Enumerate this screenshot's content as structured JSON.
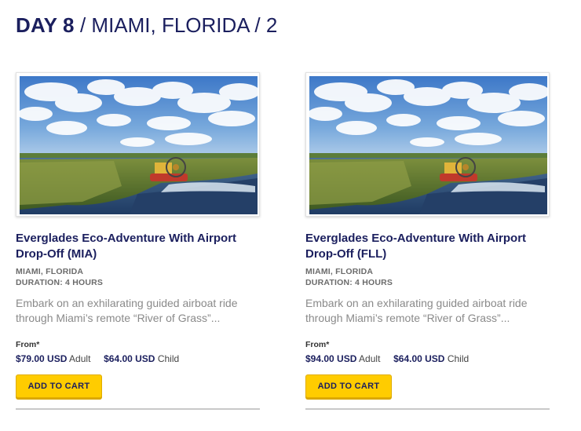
{
  "header": {
    "day_label": "DAY 8",
    "location_text": " / MIAMI, FLORIDA / 2"
  },
  "colors": {
    "brand_navy": "#1b1f5e",
    "button_yellow": "#ffcc00",
    "muted_text": "#8a8a8a"
  },
  "products": [
    {
      "image_alt": "airboat-in-everglades",
      "title": "Everglades Eco-Adventure With Airport Drop-Off (MIA)",
      "location": "MIAMI, FLORIDA",
      "duration": "DURATION: 4 HOURS",
      "description": "Embark on an exhilarating guided airboat ride through Miami’s remote “River of Grass”...",
      "from_label": "From*",
      "adult_price": "$79.00 USD",
      "adult_label": "Adult",
      "child_price": "$64.00 USD",
      "child_label": "Child",
      "button_label": "ADD TO CART"
    },
    {
      "image_alt": "airboat-in-everglades",
      "title": "Everglades Eco-Adventure With Airport Drop-Off (FLL)",
      "location": "MIAMI, FLORIDA",
      "duration": "DURATION: 4 HOURS",
      "description": "Embark on an exhilarating guided airboat ride through Miami’s remote “River of Grass”...",
      "from_label": "From*",
      "adult_price": "$94.00 USD",
      "adult_label": "Adult",
      "child_price": "$64.00 USD",
      "child_label": "Child",
      "button_label": "ADD TO CART"
    }
  ]
}
